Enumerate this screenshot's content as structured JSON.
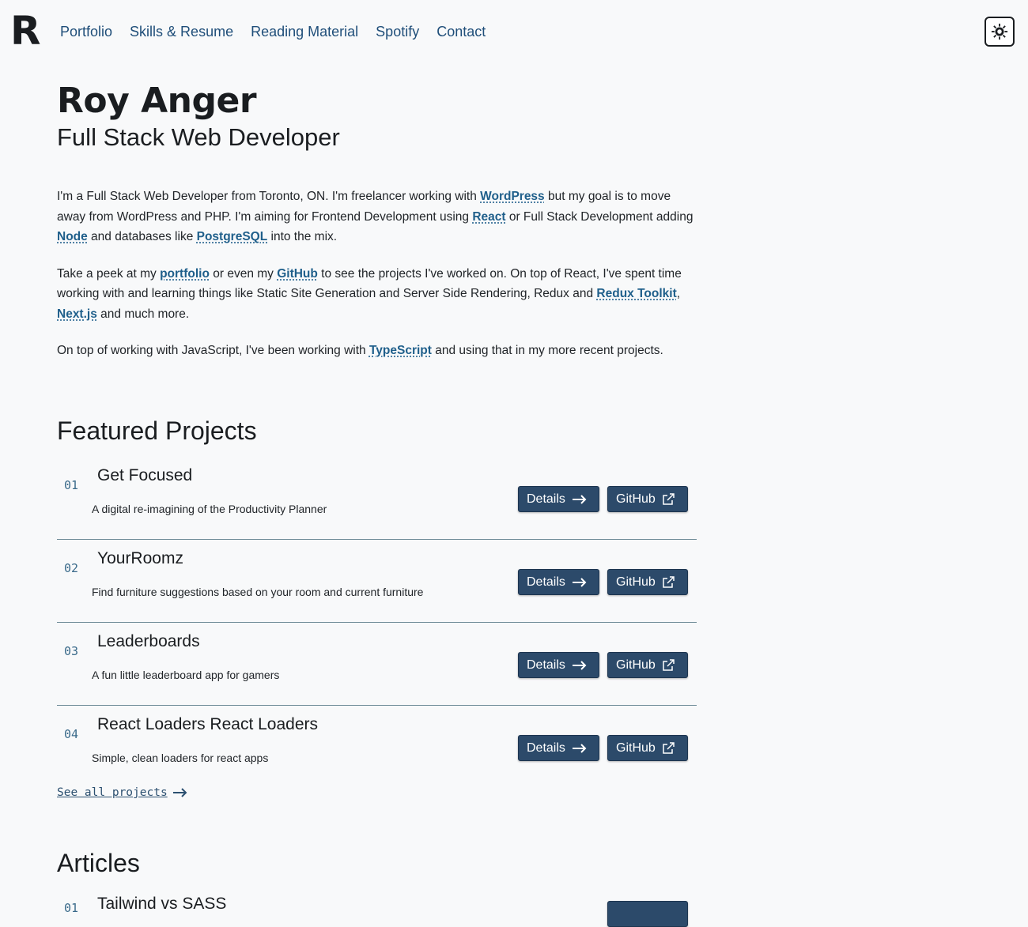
{
  "header": {
    "logo": "R",
    "nav": [
      "Portfolio",
      "Skills & Resume",
      "Reading Material",
      "Spotify",
      "Contact"
    ],
    "theme_toggle_icon": "sun-gear-icon"
  },
  "hero": {
    "name": "Roy Anger",
    "subtitle": "Full Stack Web Developer"
  },
  "intro": {
    "p1": {
      "t1": "I'm a Full Stack Web Developer from Toronto, ON. I'm freelancer working with ",
      "l1": "WordPress",
      "t2": " but my goal is to move away from WordPress and PHP. I'm aiming for Frontend Development using ",
      "l2": "React",
      "t3": " or Full Stack Development adding ",
      "l3": "Node",
      "t4": " and databases like ",
      "l4": "PostgreSQL",
      "t5": " into the mix."
    },
    "p2": {
      "t1": "Take a peek at my ",
      "l1": "portfolio",
      "t2": " or even my ",
      "l2": "GitHub",
      "t3": " to see the projects I've worked on. On top of React, I've spent time working with and learning things like Static Site Generation and Server Side Rendering, Redux and ",
      "l3": "Redux Toolkit",
      "t4": ", ",
      "l4": "Next.js",
      "t5": " and much more."
    },
    "p3": {
      "t1": "On top of working with JavaScript, I've been working with ",
      "l1": "TypeScript",
      "t2": " and using that in my more recent projects."
    }
  },
  "featured": {
    "title": "Featured Projects",
    "details_label": "Details",
    "github_label": "GitHub",
    "projects": [
      {
        "num": "01",
        "title": "Get Focused",
        "desc": "A digital re-imagining of the Productivity Planner"
      },
      {
        "num": "02",
        "title": "YourRoomz",
        "desc": "Find furniture suggestions based on your room and current furniture"
      },
      {
        "num": "03",
        "title": "Leaderboards",
        "desc": "A fun little leaderboard app for gamers"
      },
      {
        "num": "04",
        "title": "React Loaders React Loaders",
        "desc": "Simple, clean loaders for react apps"
      }
    ],
    "see_all": "See all projects"
  },
  "articles": {
    "title": "Articles",
    "items": [
      {
        "num": "01",
        "title": "Tailwind vs SASS"
      }
    ]
  },
  "colors": {
    "button_bg": "#2c4a6a",
    "link": "#1f5f8b",
    "background": "#f8f9fa"
  }
}
